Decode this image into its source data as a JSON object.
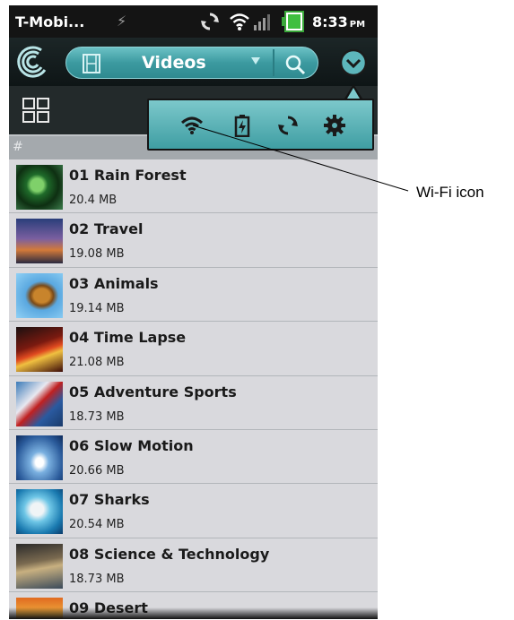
{
  "status_bar": {
    "carrier": "T-Mobi...",
    "time": "8:33",
    "ampm": "PM",
    "icons": [
      "usb-charge-icon",
      "sync-icon",
      "wifi-icon",
      "signal-icon",
      "battery-icon"
    ]
  },
  "action_bar": {
    "category": "Videos",
    "icons": [
      "app-logo-icon",
      "film-icon",
      "dropdown-arrow-icon",
      "search-icon",
      "overflow-menu-icon"
    ]
  },
  "toolbar": {
    "icons": [
      "grid-view-icon"
    ]
  },
  "quick_settings": {
    "icons": [
      "wifi-icon",
      "battery-icon",
      "sync-icon",
      "settings-gear-icon"
    ]
  },
  "section_header": "#",
  "videos": [
    {
      "title": "01 Rain Forest",
      "size": "20.4 MB"
    },
    {
      "title": "02 Travel",
      "size": "19.08 MB"
    },
    {
      "title": "03 Animals",
      "size": "19.14 MB"
    },
    {
      "title": "04 Time Lapse",
      "size": "21.08 MB"
    },
    {
      "title": "05 Adventure Sports",
      "size": "18.73 MB"
    },
    {
      "title": "06 Slow Motion",
      "size": "20.66 MB"
    },
    {
      "title": "07 Sharks",
      "size": "20.54 MB"
    },
    {
      "title": "08 Science & Technology",
      "size": "18.73 MB"
    },
    {
      "title": "09 Desert",
      "size": ""
    }
  ],
  "callout": {
    "label": "Wi-Fi icon"
  },
  "colors": {
    "accent_teal": "#4fb0b5",
    "status_bar": "#141414",
    "list_bg": "#d9d9dd"
  }
}
